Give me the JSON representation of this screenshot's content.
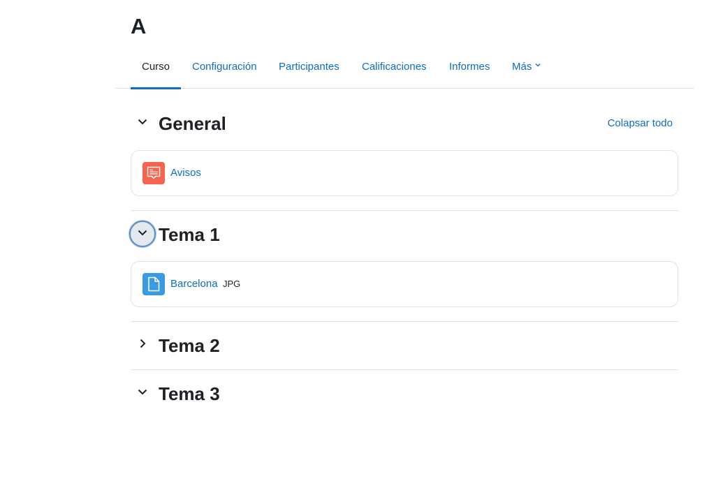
{
  "course": {
    "title": "A"
  },
  "nav": {
    "tabs": [
      {
        "label": "Curso",
        "active": true
      },
      {
        "label": "Configuración"
      },
      {
        "label": "Participantes"
      },
      {
        "label": "Calificaciones"
      },
      {
        "label": "Informes"
      },
      {
        "label": "Más"
      }
    ]
  },
  "sections": [
    {
      "title": "General",
      "expanded": true,
      "activities": [
        {
          "name": "Avisos",
          "icon": "forum-icon"
        }
      ]
    },
    {
      "title": "Tema 1",
      "expanded": true,
      "activities": [
        {
          "name": "Barcelona",
          "type": "JPG",
          "icon": "file-icon"
        }
      ]
    },
    {
      "title": "Tema 2",
      "expanded": false,
      "activities": []
    },
    {
      "title": "Tema 3",
      "expanded": true,
      "activities": []
    }
  ],
  "actions": {
    "collapse_all": "Colapsar todo"
  },
  "colors": {
    "link": "#0f6cbf",
    "forum": "#f7634d",
    "resource": "#399be2",
    "border": "#dee2e6"
  }
}
